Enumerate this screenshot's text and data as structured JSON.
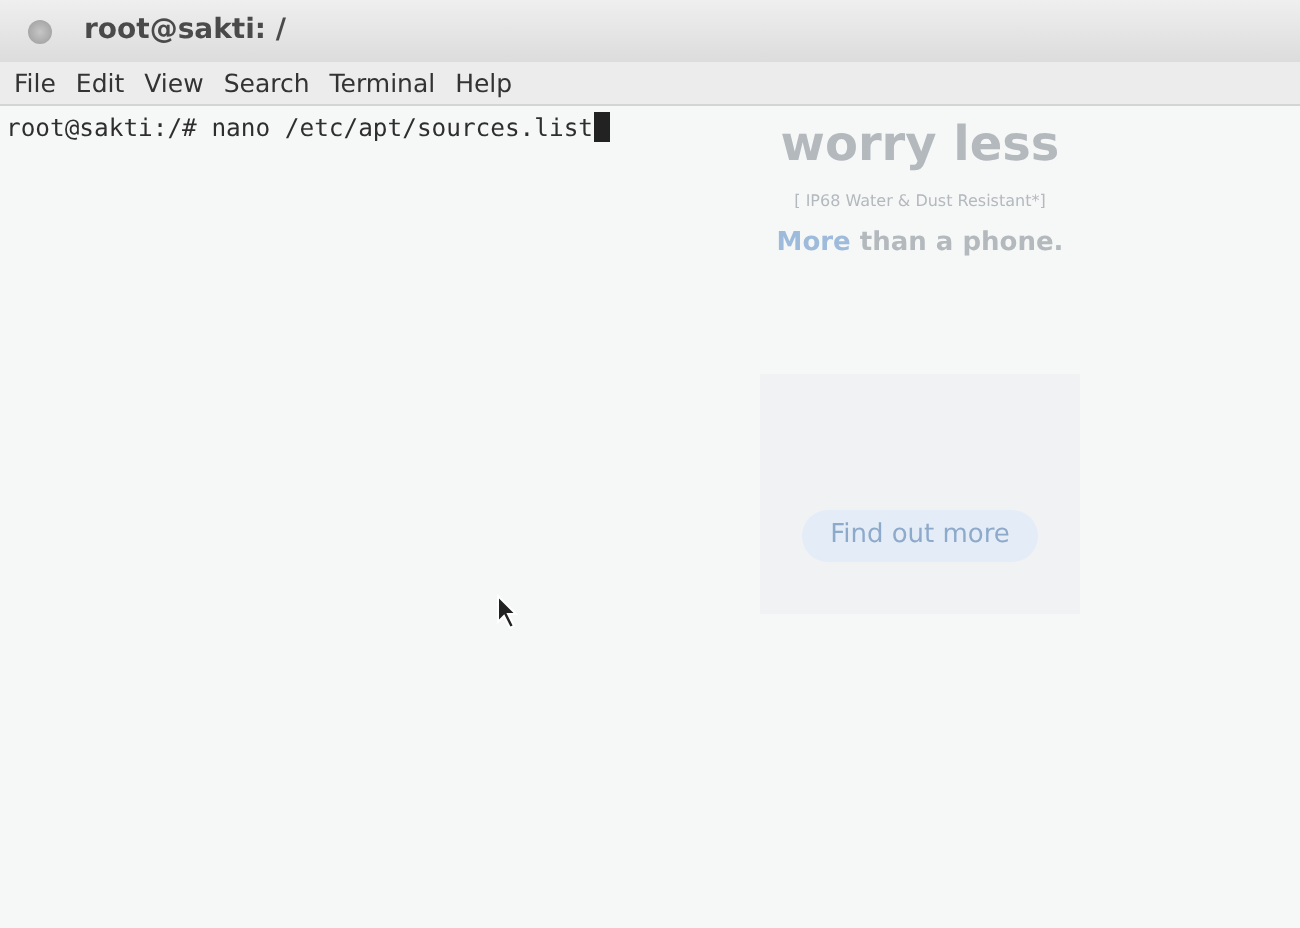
{
  "window": {
    "title": "root@sakti: /"
  },
  "menu": [
    "File",
    "Edit",
    "View",
    "Search",
    "Terminal",
    "Help"
  ],
  "terminal": {
    "lines": [
      "root@sakti:/# nano /etc/apt/sources.list"
    ],
    "cursor": true
  },
  "background_page": {
    "headline": "worry less",
    "note": "[ IP68 Water & Dust Resistant*]",
    "tagline_highlight": "More",
    "tagline_rest": " than a phone.",
    "button": "Find out more"
  }
}
